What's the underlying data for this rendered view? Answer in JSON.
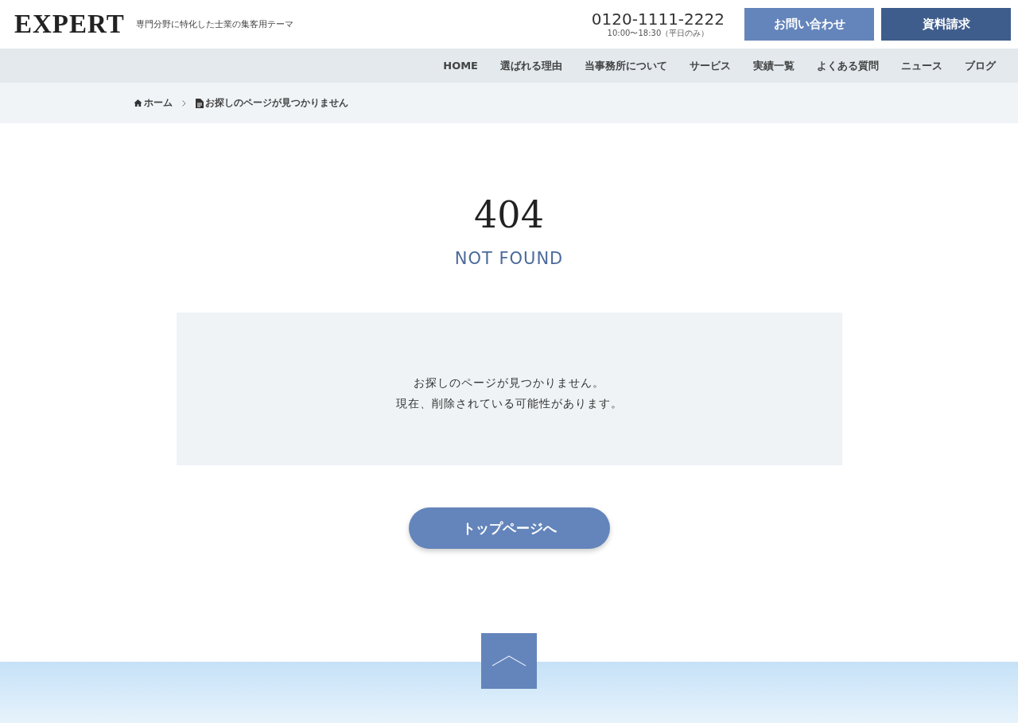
{
  "header": {
    "logo": "EXPERT",
    "tagline": "専門分野に特化した士業の集客用テーマ",
    "phone": "0120-1111-2222",
    "hours": "10:00〜18:30（平日のみ）",
    "buttons": [
      {
        "label": "お問い合わせ",
        "kind": "contact"
      },
      {
        "label": "資料請求",
        "kind": "request"
      }
    ]
  },
  "nav": [
    "HOME",
    "選ばれる理由",
    "当事務所について",
    "サービス",
    "実績一覧",
    "よくある質問",
    "ニュース",
    "ブログ"
  ],
  "breadcrumb": [
    {
      "label": "ホーム",
      "kind": "home"
    },
    {
      "label": "お探しのページが見つかりません",
      "kind": "page"
    }
  ],
  "error": {
    "code": "404",
    "title": "NOT FOUND",
    "messages": [
      "お探しのページが見つかりません。",
      "現在、削除されている可能性があります。"
    ],
    "button": "トップページへ"
  }
}
